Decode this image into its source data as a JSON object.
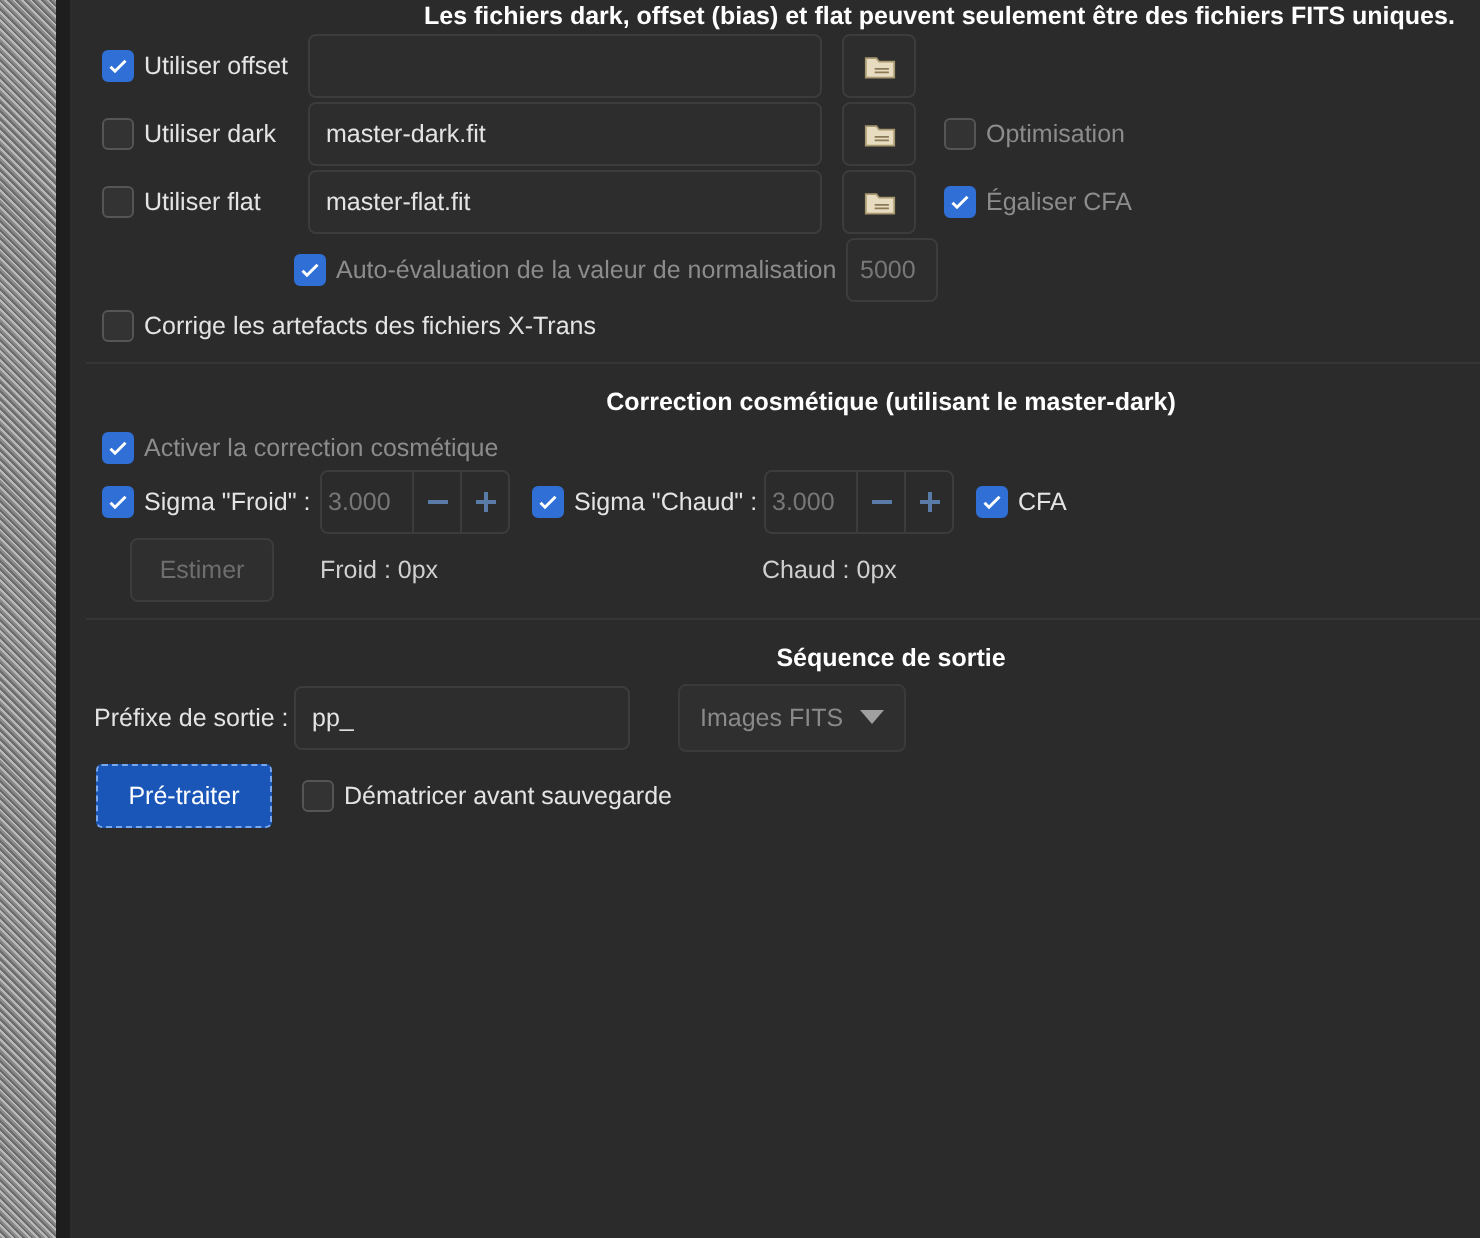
{
  "notice": "Les fichiers dark, offset (bias) et flat peuvent seulement être des fichiers FITS uniques.",
  "masters": [
    {
      "label": "Utiliser offset",
      "checked": true
    },
    {
      "label": "Utiliser dark",
      "checked": false,
      "file": "master-dark.fit",
      "option": {
        "label": "Optimisation",
        "checked": false,
        "disabled": true
      }
    },
    {
      "label": "Utiliser flat",
      "checked": false,
      "file": "master-flat.fit",
      "option": {
        "label": "Égaliser CFA",
        "checked": true,
        "disabled": true
      }
    }
  ],
  "normalisation": {
    "label": "Auto-évaluation de la valeur de normalisation",
    "checked": true,
    "disabled": true,
    "value": "5000"
  },
  "xtrans": {
    "label": "Corrige les artefacts des fichiers X-Trans",
    "checked": false
  },
  "cosmetic": {
    "title": "Correction cosmétique (utilisant le master-dark)",
    "enable": {
      "label": "Activer la correction cosmétique",
      "checked": true,
      "disabled": true
    },
    "sigmas": [
      {
        "label": "Sigma \"Froid\" :",
        "checked": true,
        "value": "3.000",
        "result": "Froid : 0px"
      },
      {
        "label": "Sigma \"Chaud\" :",
        "checked": true,
        "value": "3.000",
        "result": "Chaud : 0px"
      }
    ],
    "cfa": {
      "label": "CFA",
      "checked": true
    },
    "estimate": {
      "label": "Estimer",
      "disabled": true
    }
  },
  "output": {
    "title": "Séquence de sortie",
    "prefix_label": "Préfixe de sortie :",
    "prefix": "pp_",
    "format": "Images FITS",
    "format_disabled": true,
    "run": {
      "label": "Pré-traiter"
    },
    "debayer": {
      "label": "Dématricer avant sauvegarde",
      "checked": false
    }
  }
}
